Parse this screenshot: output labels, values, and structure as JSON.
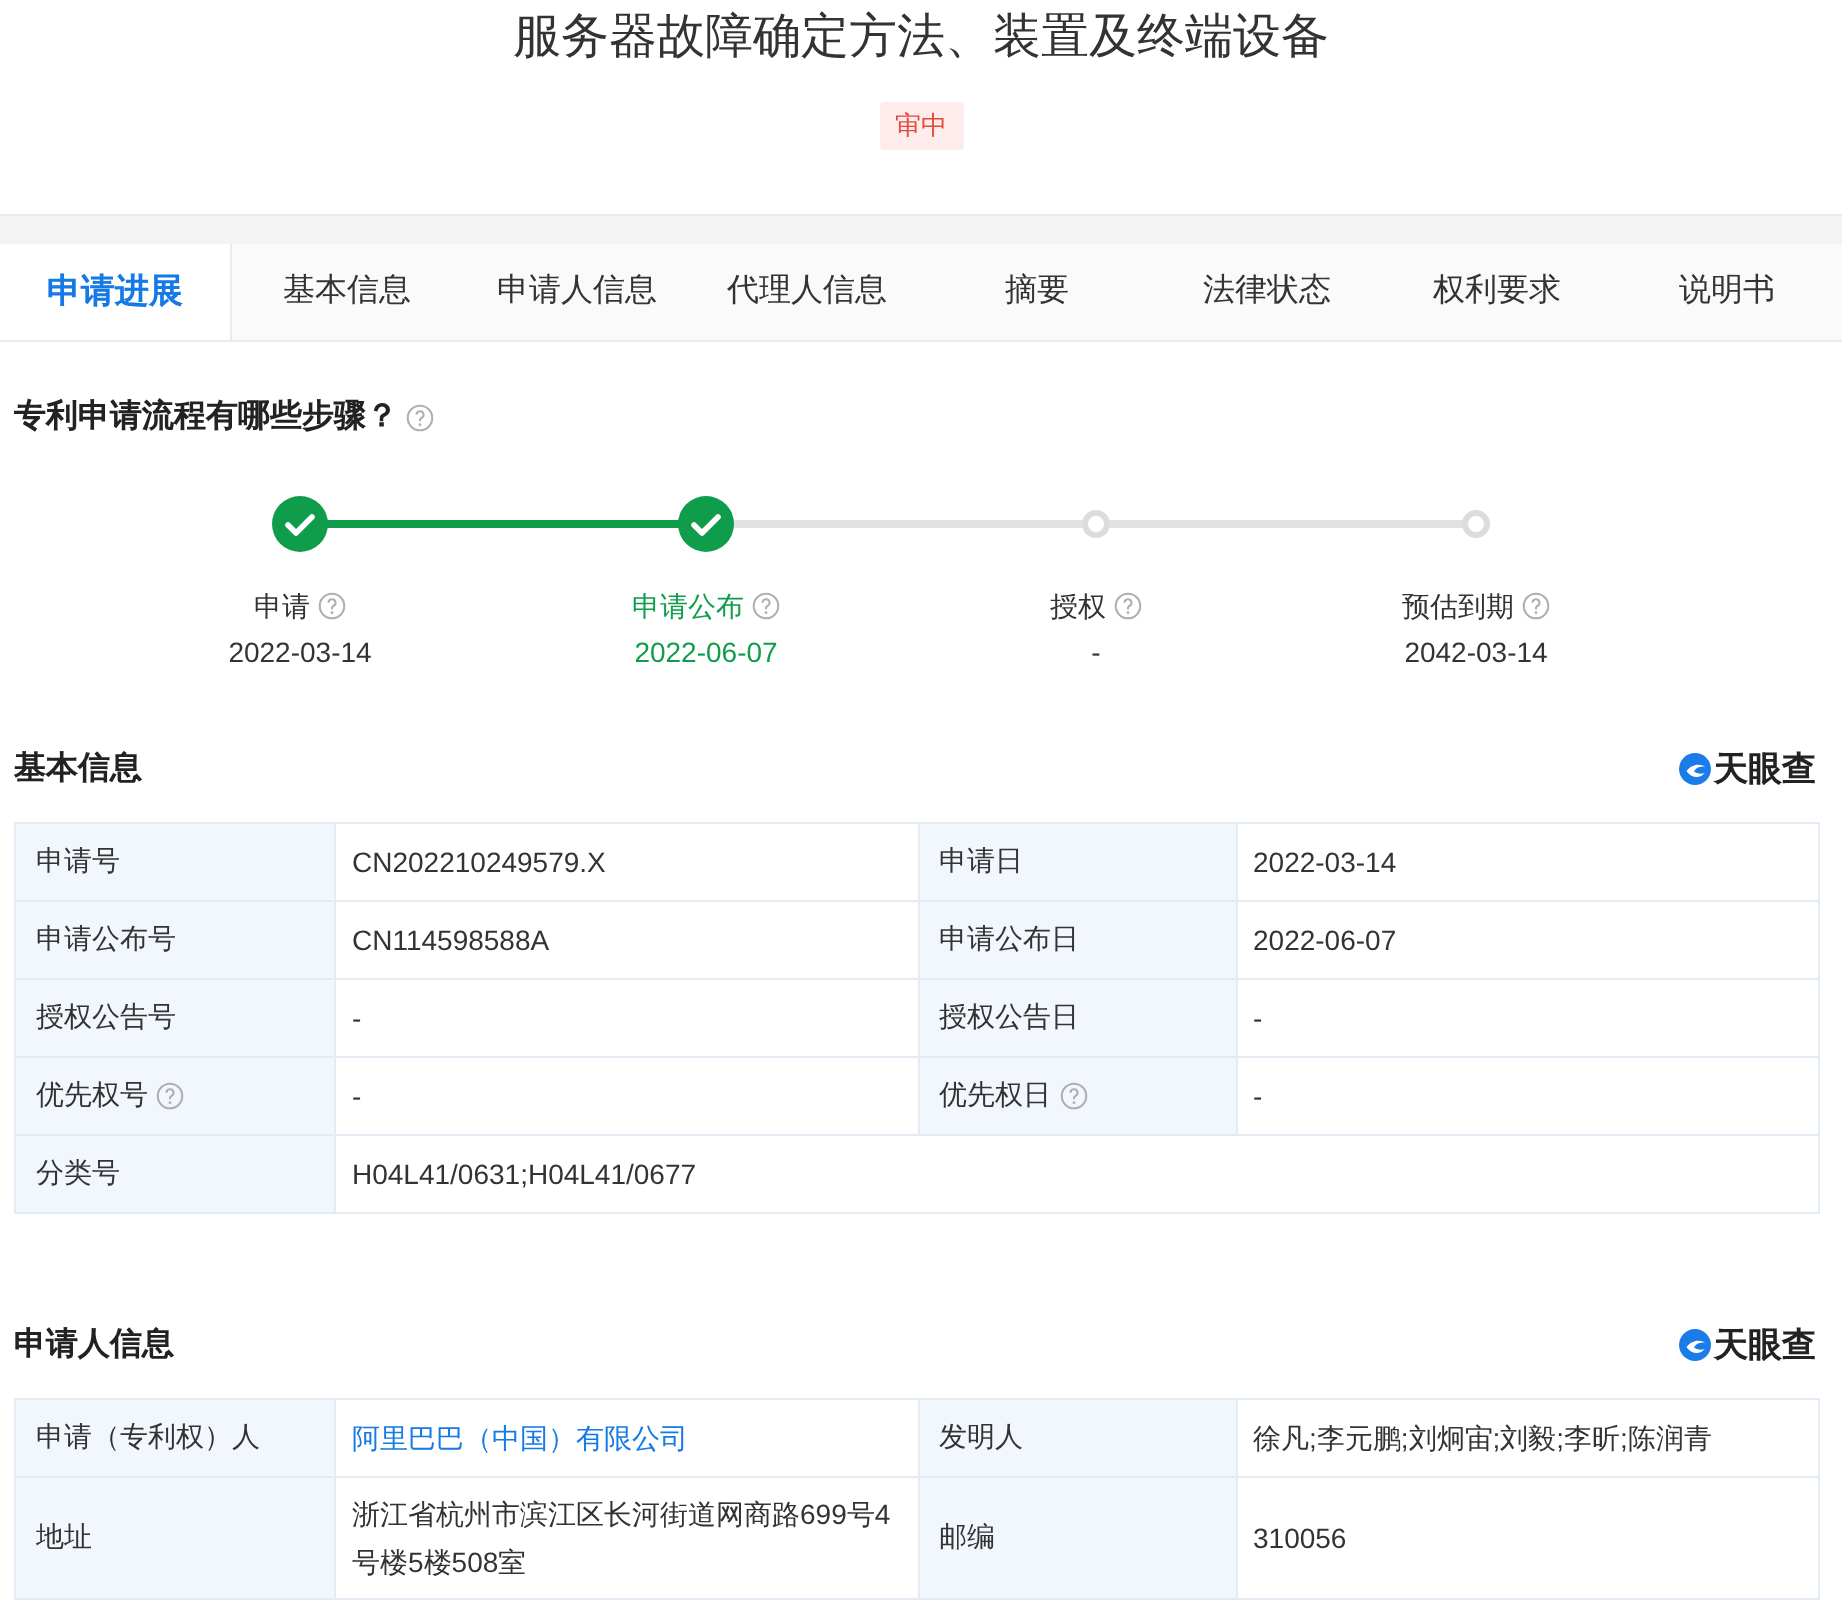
{
  "title": "服务器故障确定方法、装置及终端设备",
  "status_badge": "审中",
  "tabs": [
    {
      "label": "申请进展",
      "selected": true
    },
    {
      "label": "基本信息",
      "selected": false
    },
    {
      "label": "申请人信息",
      "selected": false
    },
    {
      "label": "代理人信息",
      "selected": false
    },
    {
      "label": "摘要",
      "selected": false
    },
    {
      "label": "法律状态",
      "selected": false
    },
    {
      "label": "权利要求",
      "selected": false
    },
    {
      "label": "说明书",
      "selected": false
    }
  ],
  "progress": {
    "heading": "专利申请流程有哪些步骤？",
    "steps": [
      {
        "label": "申请",
        "date": "2022-03-14",
        "done": true,
        "selected": false
      },
      {
        "label": "申请公布",
        "date": "2022-06-07",
        "done": true,
        "selected": true
      },
      {
        "label": "授权",
        "date": "-",
        "done": false,
        "selected": false
      },
      {
        "label": "预估到期",
        "date": "2042-03-14",
        "done": false,
        "selected": false
      }
    ]
  },
  "sections": [
    {
      "heading": "基本信息",
      "source_logo": "天眼查",
      "rows": [
        [
          {
            "label": "申请号",
            "value": "CN202210249579.X"
          },
          {
            "label": "申请日",
            "value": "2022-03-14"
          }
        ],
        [
          {
            "label": "申请公布号",
            "value": "CN114598588A"
          },
          {
            "label": "申请公布日",
            "value": "2022-06-07"
          }
        ],
        [
          {
            "label": "授权公告号",
            "value": "-"
          },
          {
            "label": "授权公告日",
            "value": "-"
          }
        ],
        [
          {
            "label": "优先权号",
            "value": "-",
            "help": true
          },
          {
            "label": "优先权日",
            "value": "-",
            "help": true
          }
        ],
        [
          {
            "label": "分类号",
            "value": "H04L41/0631;H04L41/0677"
          }
        ]
      ]
    },
    {
      "heading": "申请人信息",
      "source_logo": "天眼查",
      "rows": [
        [
          {
            "label": "申请（专利权）人",
            "value": "阿里巴巴（中国）有限公司",
            "link": true
          },
          {
            "label": "发明人",
            "value": "徐凡;李元鹏;刘炯宙;刘毅;李昕;陈润青"
          }
        ],
        [
          {
            "label": "地址",
            "value": "浙江省杭州市滨江区长河街道网商路699号4号楼5楼508室"
          },
          {
            "label": "邮编",
            "value": "310056"
          }
        ]
      ]
    }
  ]
}
